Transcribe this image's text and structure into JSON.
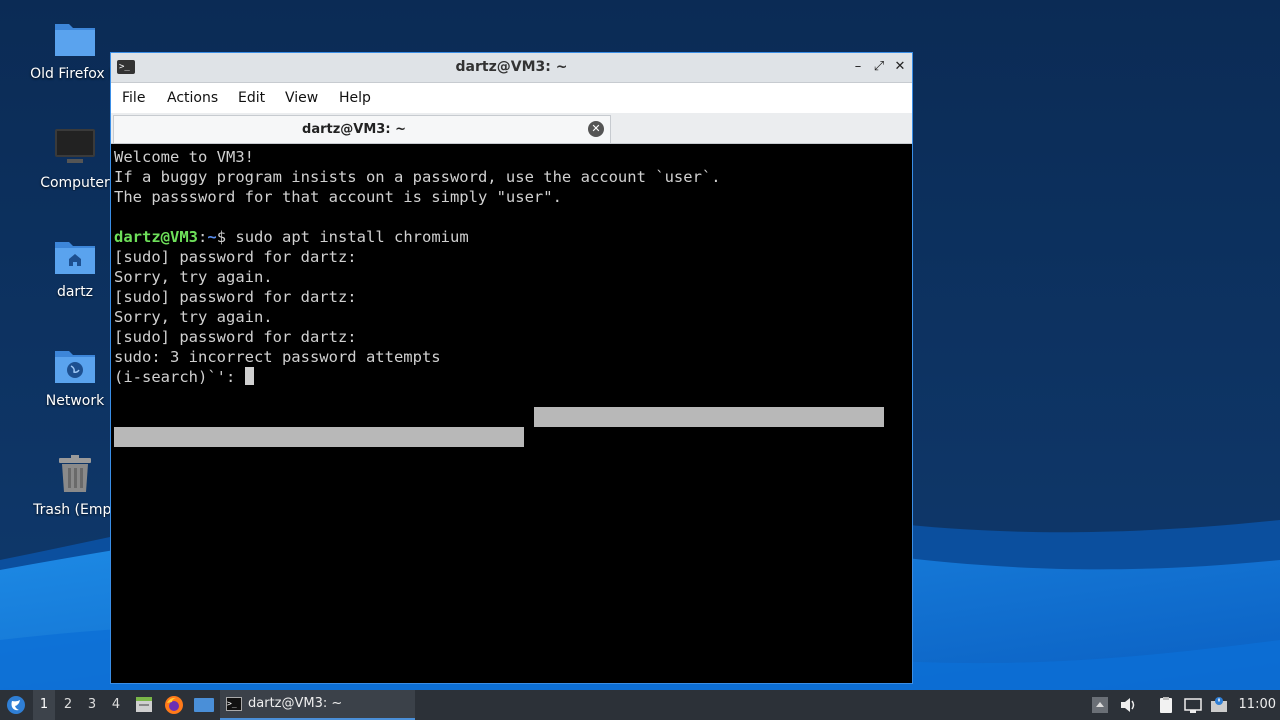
{
  "desktop": {
    "icons": [
      {
        "label": "Old Firefox D"
      },
      {
        "label": "Computer"
      },
      {
        "label": "dartz"
      },
      {
        "label": "Network"
      },
      {
        "label": "Trash (Empt"
      }
    ]
  },
  "window": {
    "title": "dartz@VM3: ~",
    "menu": [
      "File",
      "Actions",
      "Edit",
      "View",
      "Help"
    ],
    "tab_label": "dartz@VM3: ~",
    "controls": {
      "minimize": "–",
      "maximize": "⤢",
      "close": "✕"
    }
  },
  "terminal": {
    "lines": [
      "Welcome to VM3!",
      "If a buggy program insists on a password, use the account `user`.",
      "The passsword for that account is simply \"user\".",
      "",
      "",
      "[sudo] password for dartz:",
      "Sorry, try again.",
      "[sudo] password for dartz:",
      "Sorry, try again.",
      "[sudo] password for dartz:",
      "sudo: 3 incorrect password attempts",
      "(i-search)`': "
    ],
    "prompt_user": "dartz@VM3",
    "prompt_sep": ":",
    "prompt_path": "~",
    "prompt_symbol": "$",
    "command": " sudo apt install chromium"
  },
  "taskbar": {
    "workspaces": [
      "1",
      "2",
      "3",
      "4"
    ],
    "active_workspace": "1",
    "task_label": "dartz@VM3: ~",
    "clock": "11:00",
    "icons": [
      "start-menu-icon",
      "file-manager-icon",
      "firefox-icon",
      "show-desktop-icon",
      "terminal-icon",
      "tray-arrow-icon",
      "volume-icon",
      "clipboard-icon",
      "network-icon",
      "notification-icon"
    ]
  },
  "colors": {
    "prompt_user": "#6ee05a",
    "prompt_path": "#5b8ff0",
    "window_border": "#3a8ee6",
    "taskbar": "#2c3138"
  }
}
